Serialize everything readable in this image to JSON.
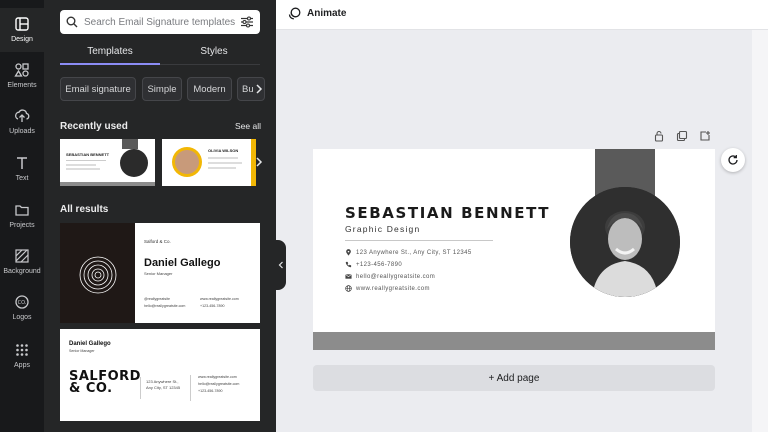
{
  "rail": {
    "items": [
      {
        "label": "Design",
        "icon": "design-icon"
      },
      {
        "label": "Elements",
        "icon": "elements-icon"
      },
      {
        "label": "Uploads",
        "icon": "uploads-icon"
      },
      {
        "label": "Text",
        "icon": "text-icon"
      },
      {
        "label": "Projects",
        "icon": "projects-icon"
      },
      {
        "label": "Background",
        "icon": "background-icon"
      },
      {
        "label": "Logos",
        "icon": "logos-icon"
      },
      {
        "label": "Apps",
        "icon": "apps-icon"
      }
    ]
  },
  "panel": {
    "search": {
      "placeholder": "Search Email Signature templates"
    },
    "tabs": [
      "Templates",
      "Styles"
    ],
    "chips": [
      "Email signature",
      "Simple",
      "Modern",
      "Bu"
    ],
    "recently_used": "Recently used",
    "see_all": "See all",
    "all_results": "All results",
    "thumb1": {
      "name": "SEBASTIAN BENNETT"
    },
    "thumb2": {
      "name": "OLIVIA WILSON"
    },
    "result1": {
      "company": "Salford & Co.",
      "name": "Daniel Gallego",
      "role": "Senior Manager",
      "web": "@reallygreatsite",
      "mail": "hello@reallygreatsite.com",
      "phone": "+123-456-7890",
      "site": "www.reallygreatsite.com"
    },
    "result2": {
      "name": "Daniel Gallego",
      "role": "Senior Manager",
      "logo_line1": "SALFORD",
      "logo_line2": "& CO.",
      "addr1": "123 Anywhere St.,",
      "addr2": "Any City, ST 12345",
      "site": "www.reallygreatsite.com",
      "mail": "hello@reallygreatsite.com",
      "phone": "+123-456-7890"
    }
  },
  "topbar": {
    "animate": "Animate"
  },
  "signature": {
    "name": "SEBASTIAN BENNETT",
    "title": "Graphic Design",
    "address": "123 Anywhere St., Any City, ST 12345",
    "phone": "+123-456-7890",
    "email": "hello@reallygreatsite.com",
    "website": "www.reallygreatsite.com"
  },
  "add_page": "+ Add page",
  "colors": {
    "accent": "#8b8cf5",
    "panel": "#252627",
    "rail": "#18191b"
  }
}
